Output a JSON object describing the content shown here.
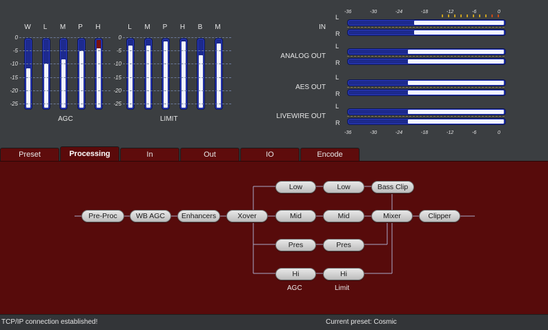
{
  "agc": {
    "label": "AGC",
    "channels": [
      {
        "name": "W",
        "level": 0.58
      },
      {
        "name": "L",
        "level": 0.65
      },
      {
        "name": "M",
        "level": 0.71
      },
      {
        "name": "P",
        "level": 0.84
      },
      {
        "name": "H",
        "level": 0.88,
        "peak": true
      }
    ],
    "scale": [
      "0",
      "-5",
      "-10",
      "-15",
      "-20",
      "-25"
    ]
  },
  "limit": {
    "label": "LIMIT",
    "channels": [
      {
        "name": "L",
        "level": 0.92
      },
      {
        "name": "M",
        "level": 0.92
      },
      {
        "name": "P",
        "level": 0.98
      },
      {
        "name": "H",
        "level": 0.98
      },
      {
        "name": "B",
        "level": 0.78
      },
      {
        "name": "M",
        "level": 0.95
      }
    ],
    "scale": [
      "0",
      "-5",
      "-10",
      "-15",
      "-20",
      "-25"
    ]
  },
  "level_meters": {
    "scale": [
      "-36",
      "-30",
      "-24",
      "-18",
      "-12",
      "-6",
      "0"
    ],
    "groups": [
      {
        "label": "IN",
        "L": 0.58,
        "R": 0.58
      },
      {
        "label": "ANALOG OUT",
        "L": 0.62,
        "R": 0.62
      },
      {
        "label": "AES OUT",
        "L": 0.62,
        "R": 0.62
      },
      {
        "label": "LIVEWIRE OUT",
        "L": 0.62,
        "R": 0.62
      }
    ],
    "channel_labels": {
      "left": "L",
      "right": "R"
    }
  },
  "tabs": [
    {
      "label": "Preset",
      "active": false
    },
    {
      "label": "Processing",
      "active": true
    },
    {
      "label": "In",
      "active": false
    },
    {
      "label": "Out",
      "active": false
    },
    {
      "label": "IO",
      "active": false
    },
    {
      "label": "Encode",
      "active": false
    }
  ],
  "processing": {
    "nodes": {
      "pre_proc": "Pre-Proc",
      "wb_agc": "WB AGC",
      "enhancers": "Enhancers",
      "xover": "Xover",
      "agc_low": "Low",
      "agc_mid": "Mid",
      "agc_pres": "Pres",
      "agc_hi": "Hi",
      "lim_low": "Low",
      "lim_mid": "Mid",
      "lim_pres": "Pres",
      "lim_hi": "Hi",
      "bass_clip": "Bass Clip",
      "mixer": "Mixer",
      "clipper": "Clipper"
    },
    "column_labels": {
      "agc": "AGC",
      "limit": "Limit"
    }
  },
  "status": {
    "connection": "TCP/IP connection established!",
    "preset": "Current preset: Cosmic"
  },
  "colors": {
    "meter_blue": "#1d2a8e",
    "meter_fill": "#f4f6ff",
    "panel_red": "#570b0b",
    "tab_red": "#5e0c0c",
    "peak_red": "#7a1010"
  }
}
